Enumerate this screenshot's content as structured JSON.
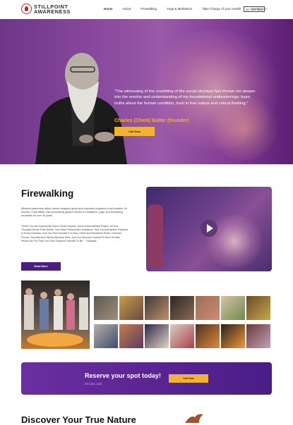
{
  "header": {
    "logo_line1": "STILLPOINT",
    "logo_line2": "AWARENESS",
    "nav": [
      "Home",
      "About",
      "Firewalking",
      "Yoga & Meditation",
      "Take Charge of your Health",
      "Contact Us"
    ],
    "phone_button": "267-251-1115"
  },
  "hero": {
    "quote": "\"The witnessing of the crumbling of the social structure has thrown me deeper into the resolve and understanding of my foundational underpinnings; basic truths about the human condition, trust in true nature and critical thinking.\"",
    "author": "Charles (Chick) Balter (founder)",
    "cta_label": "Call Now"
  },
  "firewalking": {
    "title": "Firewalking",
    "para1": "Stillpoint Awareness offers custom designed group and corporate programs in self-mastery. It's founder, Chick Balter, has successfully guided courses in meditation, yoga, and firewalking worldwide for over 30 years.",
    "para2": "\"When You Are Inspired By Some Great Purpose, Some Extraordinary Project, All Your Thoughts Break Their Bonds. Your Mind Transcends Limitations, Your Consciousness Expands In Every Direction, And You Find Yourself In A New, Great And Wonderful World. Dormant Forces, Faculties And Talents Become Alive, And You Discover Yourself To Be A Greater Person By Far Than You Ever Dreamed Yourself To Be.\" - Patanjali",
    "read_more": "Read More"
  },
  "cta": {
    "title": "Reserve your spot today!",
    "phone": "267-251-1115",
    "button": "Call Now"
  },
  "discover": {
    "title": "Discover Your True Nature"
  },
  "colors": {
    "purple": "#4c1d80",
    "gold": "#f2b233",
    "logo_red": "#b7231f"
  }
}
